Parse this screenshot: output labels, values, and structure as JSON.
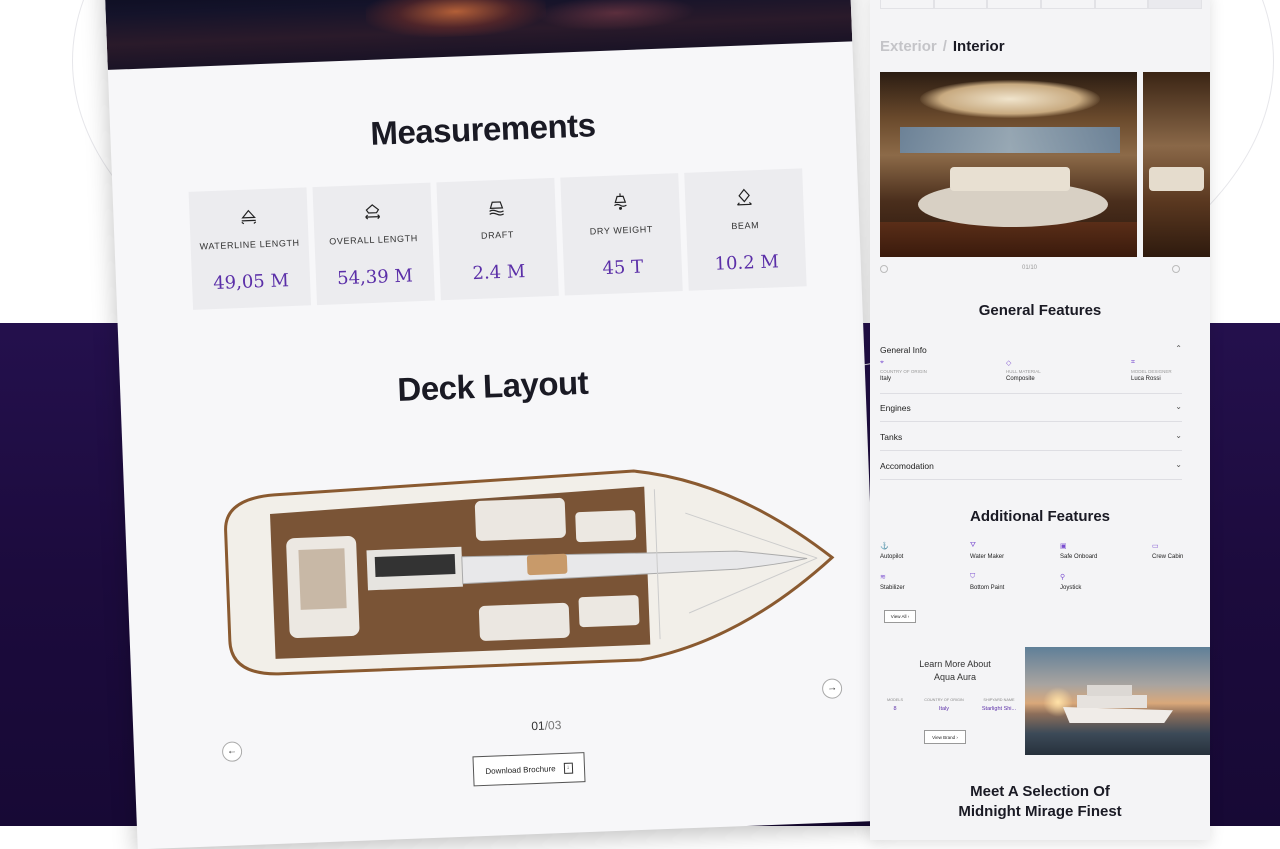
{
  "measurements": {
    "title": "Measurements",
    "items": [
      {
        "label": "WATERLINE LENGTH",
        "value": "49,05 M",
        "icon": "waterline-length-icon"
      },
      {
        "label": "OVERALL LENGTH",
        "value": "54,39 M",
        "icon": "overall-length-icon"
      },
      {
        "label": "DRAFT",
        "value": "2.4 M",
        "icon": "draft-icon"
      },
      {
        "label": "DRY WEIGHT",
        "value": "45 T",
        "icon": "dry-weight-icon"
      },
      {
        "label": "BEAM",
        "value": "10.2 M",
        "icon": "beam-icon"
      }
    ]
  },
  "deck": {
    "title": "Deck Layout",
    "pager_current": "01",
    "pager_total": "/03",
    "next_arrow": "→",
    "prev_arrow": "←",
    "brochure_label": "Download Brochure",
    "brochure_icon": "↓"
  },
  "gallery": {
    "tab_exterior": "Exterior",
    "tab_separator": "/",
    "tab_interior": "Interior",
    "pager": "01/10"
  },
  "general_features": {
    "title": "General Features",
    "general_info": {
      "label": "General Info",
      "chevron": "⌃",
      "items": [
        {
          "key": "COUNTRY OF ORIGIN",
          "value": "Italy",
          "icon": "location-pin-icon"
        },
        {
          "key": "HULL MATERIAL",
          "value": "Composite",
          "icon": "diamond-icon"
        },
        {
          "key": "MODEL DESIGNER",
          "value": "Luca Rossi",
          "icon": "designer-icon"
        }
      ]
    },
    "rows": [
      {
        "label": "Engines",
        "chevron": "⌄"
      },
      {
        "label": "Tanks",
        "chevron": "⌄"
      },
      {
        "label": "Accomodation",
        "chevron": "⌄"
      }
    ]
  },
  "additional_features": {
    "title": "Additional Features",
    "items": [
      "Autopilot",
      "Water Maker",
      "Safe Onboard",
      "Crew Cabin",
      "Stabilizer",
      "Bottom Paint",
      "Joystick"
    ],
    "view_all": "View All"
  },
  "learn_more": {
    "line1": "Learn More About",
    "line2": "Aqua Aura",
    "stats": [
      {
        "key": "MODELS",
        "value": "8"
      },
      {
        "key": "COUNTRY OF ORIGIN",
        "value": "Italy"
      },
      {
        "key": "SHIPYARD NAME",
        "value": "Starlight Shi..."
      }
    ],
    "view_brand": "View Brand"
  },
  "meet": {
    "line1": "Meet A Selection Of",
    "line2": "Midnight Mirage Finest"
  },
  "colors": {
    "accent_purple": "#5b2fa8",
    "background_purple": "#1c0b3d"
  }
}
